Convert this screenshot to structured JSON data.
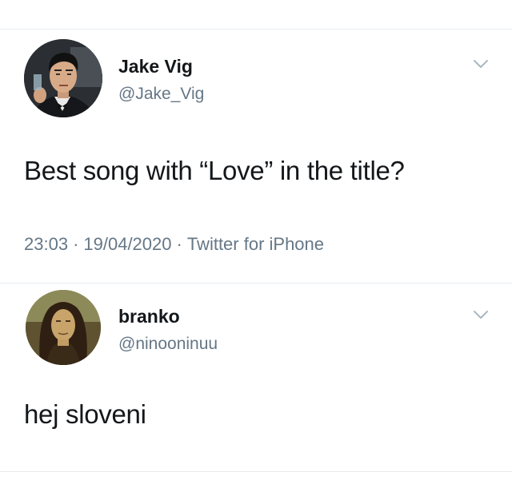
{
  "tweets": [
    {
      "name": "Jake Vig",
      "handle": "@Jake_Vig",
      "text": "Best song with “Love” in the title?",
      "time": "23:03",
      "date": "19/04/2020",
      "client": "Twitter for iPhone",
      "separator": "·"
    },
    {
      "name": "branko",
      "handle": "@ninooninuu",
      "text": "hej sloveni"
    }
  ],
  "icons": {
    "menu": "chevron-down-icon"
  },
  "colors": {
    "text": "#14171a",
    "secondary": "#657786",
    "divider": "#e6ecf0"
  }
}
